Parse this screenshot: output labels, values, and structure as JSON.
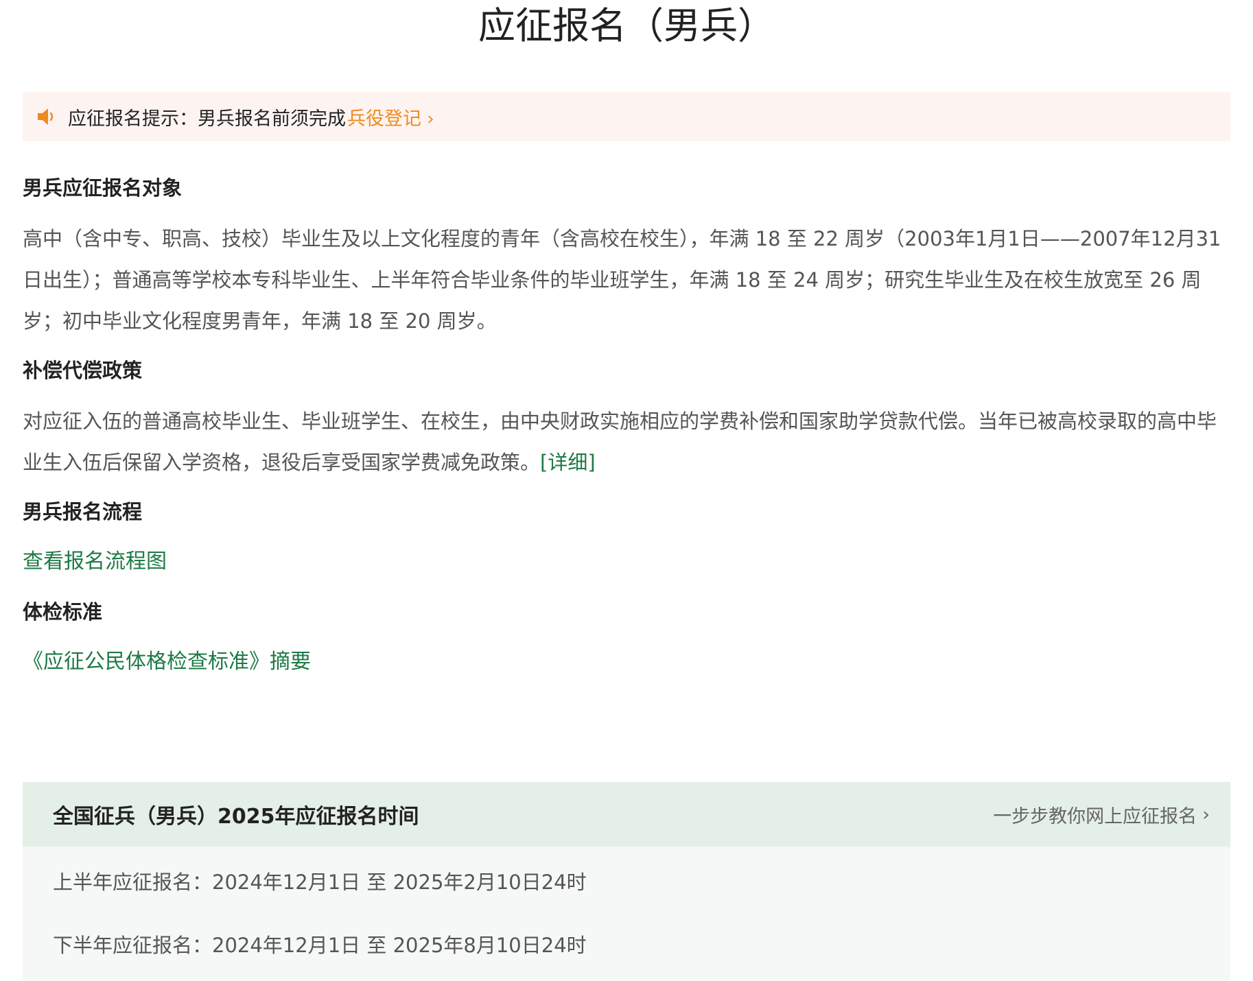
{
  "title": "应征报名（男兵）",
  "notice": {
    "label": "应征报名提示：男兵报名前须完成",
    "link": "兵役登记",
    "chevron": "›",
    "icon": "speaker-icon"
  },
  "sections": {
    "eligibility": {
      "heading": "男兵应征报名对象",
      "body": "高中（含中专、职高、技校）毕业生及以上文化程度的青年（含高校在校生），年满 18 至 22 周岁（2003年1月1日——2007年12月31日出生）；普通高等学校本专科毕业生、上半年符合毕业条件的毕业班学生，年满 18 至 24 周岁；研究生毕业生及在校生放宽至 26 周岁；初中毕业文化程度男青年，年满 18 至 20 周岁。"
    },
    "compensation": {
      "heading": "补偿代偿政策",
      "body": "对应征入伍的普通高校毕业生、毕业班学生、在校生，由中央财政实施相应的学费补偿和国家助学贷款代偿。当年已被高校录取的高中毕业生入伍后保留入学资格，退役后享受国家学费减免政策。",
      "detail_link": "[详细]"
    },
    "process": {
      "heading": "男兵报名流程",
      "link": "查看报名流程图"
    },
    "physical": {
      "heading": "体检标准",
      "link": "《应征公民体格检查标准》摘要"
    }
  },
  "schedule": {
    "title": "全国征兵（男兵）2025年应征报名时间",
    "guide_link": "一步步教你网上应征报名",
    "guide_chevron": "›",
    "rows": [
      "上半年应征报名：2024年12月1日 至 2025年2月10日24时",
      "下半年应征报名：2024年12月1日 至 2025年8月10日24时"
    ]
  },
  "colors": {
    "accent_orange": "#ee8a1f",
    "link_green": "#1c7a45",
    "notice_bg": "#fdf4f1",
    "card_header_bg": "#e4efe8"
  }
}
